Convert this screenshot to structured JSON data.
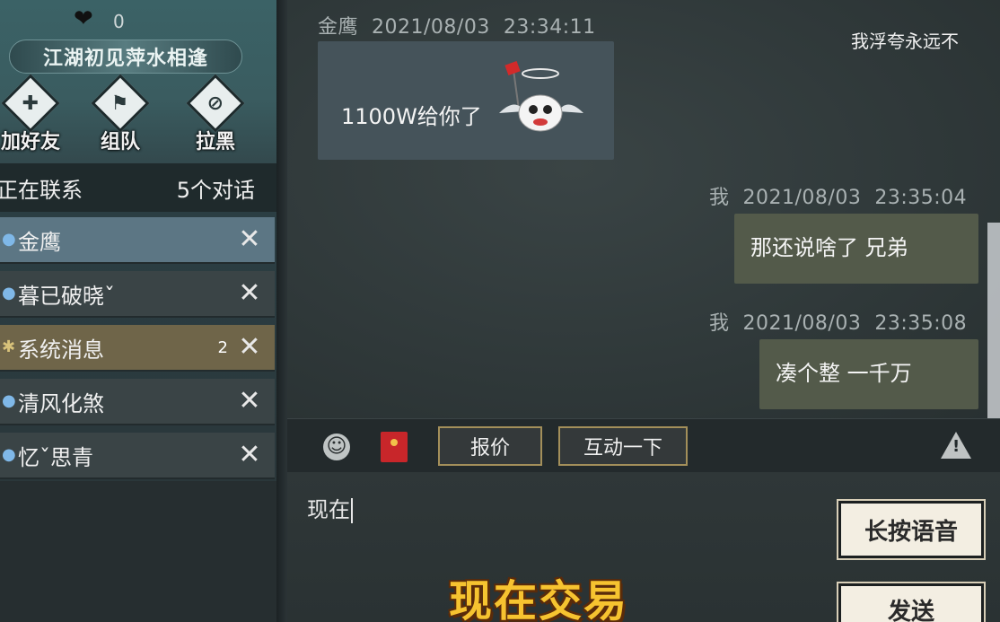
{
  "profile": {
    "likes": "0",
    "title": "江湖初见萍水相逢",
    "actions": [
      {
        "label": "加好友",
        "icon": "add-friend-icon"
      },
      {
        "label": "组队",
        "icon": "team-icon"
      },
      {
        "label": "拉黑",
        "icon": "block-icon"
      }
    ]
  },
  "contacts_header": {
    "title": "正在联系",
    "count": "5个对话"
  },
  "contacts": [
    {
      "name": "金鹰",
      "badge": ""
    },
    {
      "name": "暮已破晓ˇ",
      "badge": ""
    },
    {
      "name": "系统消息",
      "badge": "2"
    },
    {
      "name": "清风化煞",
      "badge": ""
    },
    {
      "name": "忆ˇ思青",
      "badge": ""
    }
  ],
  "close_glyph": "✕",
  "messages": [
    {
      "sender": "金鹰",
      "date": "2021/08/03",
      "time": "23:34:11",
      "text": "1100W给你了"
    },
    {
      "sender": "我",
      "date": "2021/08/03",
      "time": "23:35:04",
      "text": "那还说啥了 兄弟"
    },
    {
      "sender": "我",
      "date": "2021/08/03",
      "time": "23:35:08",
      "text": "凑个整 一千万"
    }
  ],
  "floating_text": "我浮夸永远不",
  "toolbar": {
    "quote_label": "报价",
    "interact_label": "互动一下",
    "warn_glyph": "!"
  },
  "input": {
    "value": "现在"
  },
  "buttons": {
    "voice": "长按语音",
    "send": "发送"
  },
  "caption": "现在交易",
  "colors": {
    "accent_gold": "#a38f5a",
    "active_contact": "#5c7684",
    "system_contact": "#6f6549"
  }
}
